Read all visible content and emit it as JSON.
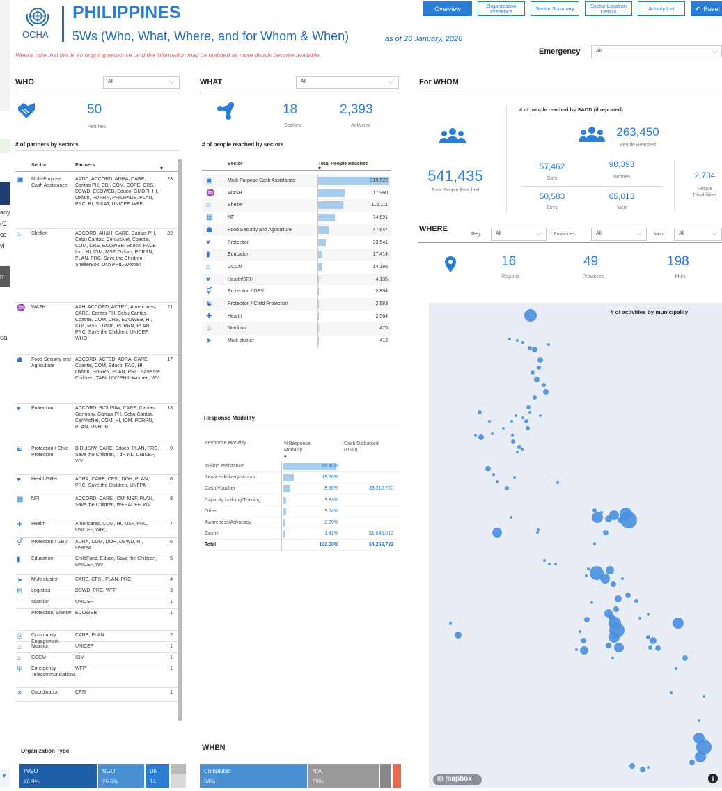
{
  "header": {
    "logo_text": "OCHA",
    "title": "PHILIPPINES",
    "subtitle": "5Ws (Who, What, Where, and for Whom & When)",
    "as_of": "as of 26 January, 2026",
    "note": "Please note that this is an ongoing response, and the information may be updated as more details become available.",
    "nav": [
      "Overview",
      "Organization Presence",
      "Sector Summary",
      "Sector Location Details",
      "Activity List",
      "Reset"
    ],
    "emergency_label": "Emergency",
    "emergency_value": "All"
  },
  "left_sliver": {
    "lines": [
      "any",
      "(C",
      "ce",
      "vi",
      "ca"
    ],
    "menu_item": "rr"
  },
  "who": {
    "label": "WHO",
    "filter": "All",
    "partners": "50",
    "partners_label": "Partners",
    "table_title": "# of partners by sectors",
    "col_sector": "Sector",
    "col_partners": "Partners",
    "rows": [
      {
        "icon": "cash-icon",
        "sector": "Multi-Purpose Cash Assistance",
        "partners": "AADC, ACCORD, ADRA, CARE, Caritas PH, CBI, COM, COPE, CRS, DSWD, ECOWEB, Educo, GMDFI, HI, Oxfam, PDRRN, PHILRADS, PLAN, PRC, RI, SIKAT, UNICEF, WFP",
        "count": "23"
      },
      {
        "icon": "shelter-icon",
        "sector": "Shelter",
        "partners": "ACCORD, AH&H, CARE, Caritas PH, Cebu Caritas, CenVisNet, Coastal, COM, CRS, ECOWEB, Educo, FACE Inc., HI, IOM, MSF, Oxfam, PDRRN, PLAN, PRC, Save the Children, ShelterBox, UNYPHIL-Women",
        "count": "22"
      },
      {
        "icon": "wash-icon",
        "sector": "WASH",
        "partners": "AAH, ACCORD, ACTED, Americares, CARE, Caritas PH, Cebu Caritas, Coastal, COM, CRS, ECOWEB, HI, IOM, MSF, Oxfam, PDRRN, PLAN, PRC, Save the Children, UNICEF, WHO",
        "count": "21"
      },
      {
        "icon": "food-icon",
        "sector": "Food Security and Agriculture",
        "partners": "ACCORD, ACTED, ADRA, CARE, Coastal, COM, Educo, FAO, HI, Oxfam, PDRRN, PLAN, PRC, Save the Children, TABI, UNYPHIL-Women, WV",
        "count": "17"
      },
      {
        "icon": "protection-icon",
        "sector": "Protection",
        "partners": "ACCORD, BIDLISIW, CARE, Caritas Germany, Caritas PH, Cebu Caritas, CenVisNet, COM, HI, IOM, PDRRN, PLAN, UNHCR",
        "count": "13"
      },
      {
        "icon": "child-protection-icon",
        "sector": "Protection / Child Protection",
        "partners": "BIDLISIW, CARE, Educo, PLAN, PRC, Save the Children, TdH NL, UNICEF, WV",
        "count": "9"
      },
      {
        "icon": "health-srh-icon",
        "sector": "Health/SRH",
        "partners": "ADRA, CARE, CFSI, DOH, PLAN, PRC, Save the Children, UNFPA",
        "count": "8"
      },
      {
        "icon": "nfi-icon",
        "sector": "NFI",
        "partners": "ACCORD, CARE, IOM, MSF, PLAN, Save the Children, WESADEF, WV",
        "count": "8"
      },
      {
        "icon": "health-icon",
        "sector": "Health",
        "partners": "Americares, COM, HI, MSF, PRC, UNICEF, WHO",
        "count": "7"
      },
      {
        "icon": "gbv-icon",
        "sector": "Protection / GBV",
        "partners": "ADRA, COM, DOH, DSWD, HI, UNFPA",
        "count": "6"
      },
      {
        "icon": "education-icon",
        "sector": "Education",
        "partners": "ChildFund, Educo, Save the Children, UNICEF, WV",
        "count": "5"
      },
      {
        "icon": "multi-cluster-icon",
        "sector": "Multi-cluster",
        "partners": "CARE, CFSI, PLAN, PRC",
        "count": "4"
      },
      {
        "icon": "logistics-icon",
        "sector": "Logistics",
        "partners": "DSWD, PRC, WFP",
        "count": "3"
      },
      {
        "icon": "",
        "sector": "Nutrition",
        "partners": "UNICEF",
        "count": "1"
      },
      {
        "icon": "",
        "sector": "Protection/ Shelter",
        "partners": "ECOWEB",
        "count": "1"
      },
      {
        "icon": "community-icon",
        "sector": "Community Engagement",
        "partners": "CARE, PLAN",
        "count": "2"
      },
      {
        "icon": "nutrition-icon",
        "sector": "Nutrition",
        "partners": "UNICEF",
        "count": "1"
      },
      {
        "icon": "cccm-icon",
        "sector": "CCCM",
        "partners": "IOM",
        "count": "1"
      },
      {
        "icon": "telecom-icon",
        "sector": "Emergency Telecommunications",
        "partners": "WFP",
        "count": "1"
      },
      {
        "icon": "coordination-icon",
        "sector": "Coordination",
        "partners": "CFSI",
        "count": "1"
      }
    ],
    "org_type_title": "Organization Type",
    "org_types": [
      {
        "label": "INGO",
        "pct": "46.9%",
        "color": "#1f5fa8"
      },
      {
        "label": "NGO",
        "pct": "26.6%",
        "color": "#4a8fd4"
      },
      {
        "label": "UN",
        "pct": "14",
        "color": "#2b7cd3"
      }
    ]
  },
  "what": {
    "label": "WHAT",
    "filter": "All",
    "sectors": "18",
    "sectors_label": "Sectors",
    "activities": "2,393",
    "activities_label": "Activities",
    "table_title": "# of people reached by sectors",
    "col_sector": "Sector",
    "col_total": "Total People Reached",
    "chart_data": {
      "type": "bar",
      "categories": [
        "Multi-Purpose Cash Assistance",
        "WASH",
        "Shelter",
        "NFI",
        "Food Security and Agriculture",
        "Protection",
        "Education",
        "CCCM",
        "Health/SRH",
        "Protection / GBV",
        "Protection / Child Protection",
        "Health",
        "Nutrition",
        "Multi-cluster"
      ],
      "values": [
        319522,
        117960,
        112111,
        74691,
        47647,
        33541,
        17414,
        14195,
        4135,
        2804,
        2583,
        2564,
        475,
        413
      ],
      "labels": [
        "319,522",
        "117,960",
        "112,111",
        "74,691",
        "47,647",
        "33,541",
        "17,414",
        "14,195",
        "4,135",
        "2,804",
        "2,583",
        "2,564",
        "475",
        "413"
      ],
      "icons": [
        "cash-icon",
        "wash-icon",
        "shelter-icon",
        "nfi-icon",
        "food-icon",
        "protection-icon",
        "education-icon",
        "cccm-icon",
        "health-srh-icon",
        "gbv-icon",
        "child-protection-icon",
        "health-icon",
        "nutrition-icon",
        "multi-cluster-icon"
      ]
    },
    "modality_title": "Response Modality",
    "modality_cols": [
      "Response Modality",
      "%Response Modality",
      "Cash Disbursed (USD)"
    ],
    "modality_rows": [
      {
        "label": "In-kind assistance",
        "pct": "66.45%",
        "frac": 0.6645,
        "cash": ""
      },
      {
        "label": "Service delivery/support",
        "pct": "13.30%",
        "frac": 0.133,
        "cash": ""
      },
      {
        "label": "Cash/Voucher",
        "pct": "8.98%",
        "frac": 0.0898,
        "cash": "$3,212,720"
      },
      {
        "label": "Capacity building/Training",
        "pct": "3.83%",
        "frac": 0.0383,
        "cash": ""
      },
      {
        "label": "Other",
        "pct": "3.74%",
        "frac": 0.0374,
        "cash": ""
      },
      {
        "label": "Awareness/Advocacy",
        "pct": "2.29%",
        "frac": 0.0229,
        "cash": ""
      },
      {
        "label": "Cash+",
        "pct": "1.41%",
        "frac": 0.0141,
        "cash": "$1,046,012"
      },
      {
        "label": "Total",
        "pct": "100.00%",
        "frac": 0,
        "cash": "$4,258,732"
      }
    ]
  },
  "when": {
    "label": "WHEN",
    "tiles": [
      {
        "label": "Completed",
        "pct": "64%",
        "color": "#4a8fd4"
      },
      {
        "label": "N/A",
        "pct": "28%",
        "color": "#9a9a9a"
      }
    ]
  },
  "forwhom": {
    "label": "For WHOM",
    "sadd_title": "# of people reached by SADD (if reported)",
    "total": "541,435",
    "total_label": "Total People Reached",
    "sadd_total": "263,450",
    "sadd_total_label": "People Reached",
    "girls": "57,462",
    "girls_label": "Girls",
    "women": "90,393",
    "women_label": "Women",
    "boys": "50,583",
    "boys_label": "Boys",
    "men": "65,013",
    "men_label": "Men",
    "disab": "2,784",
    "disab_label": "People Disabilities"
  },
  "where": {
    "label": "WHERE",
    "reg_label": "Reg.",
    "reg_value": "All",
    "prov_label": "Provinces",
    "prov_value": "All",
    "muni_label": "Muni.",
    "muni_value": "All",
    "regions": "16",
    "regions_label": "Regions",
    "provinces": "49",
    "provinces_label": "Provinces",
    "munis": "198",
    "munis_label": "Muni.",
    "map_title": "# of activities by municipality",
    "attribution": "mapbox"
  },
  "colors": {
    "accent": "#2b7cd3",
    "bar": "#a7cdee",
    "note": "#e06060"
  }
}
